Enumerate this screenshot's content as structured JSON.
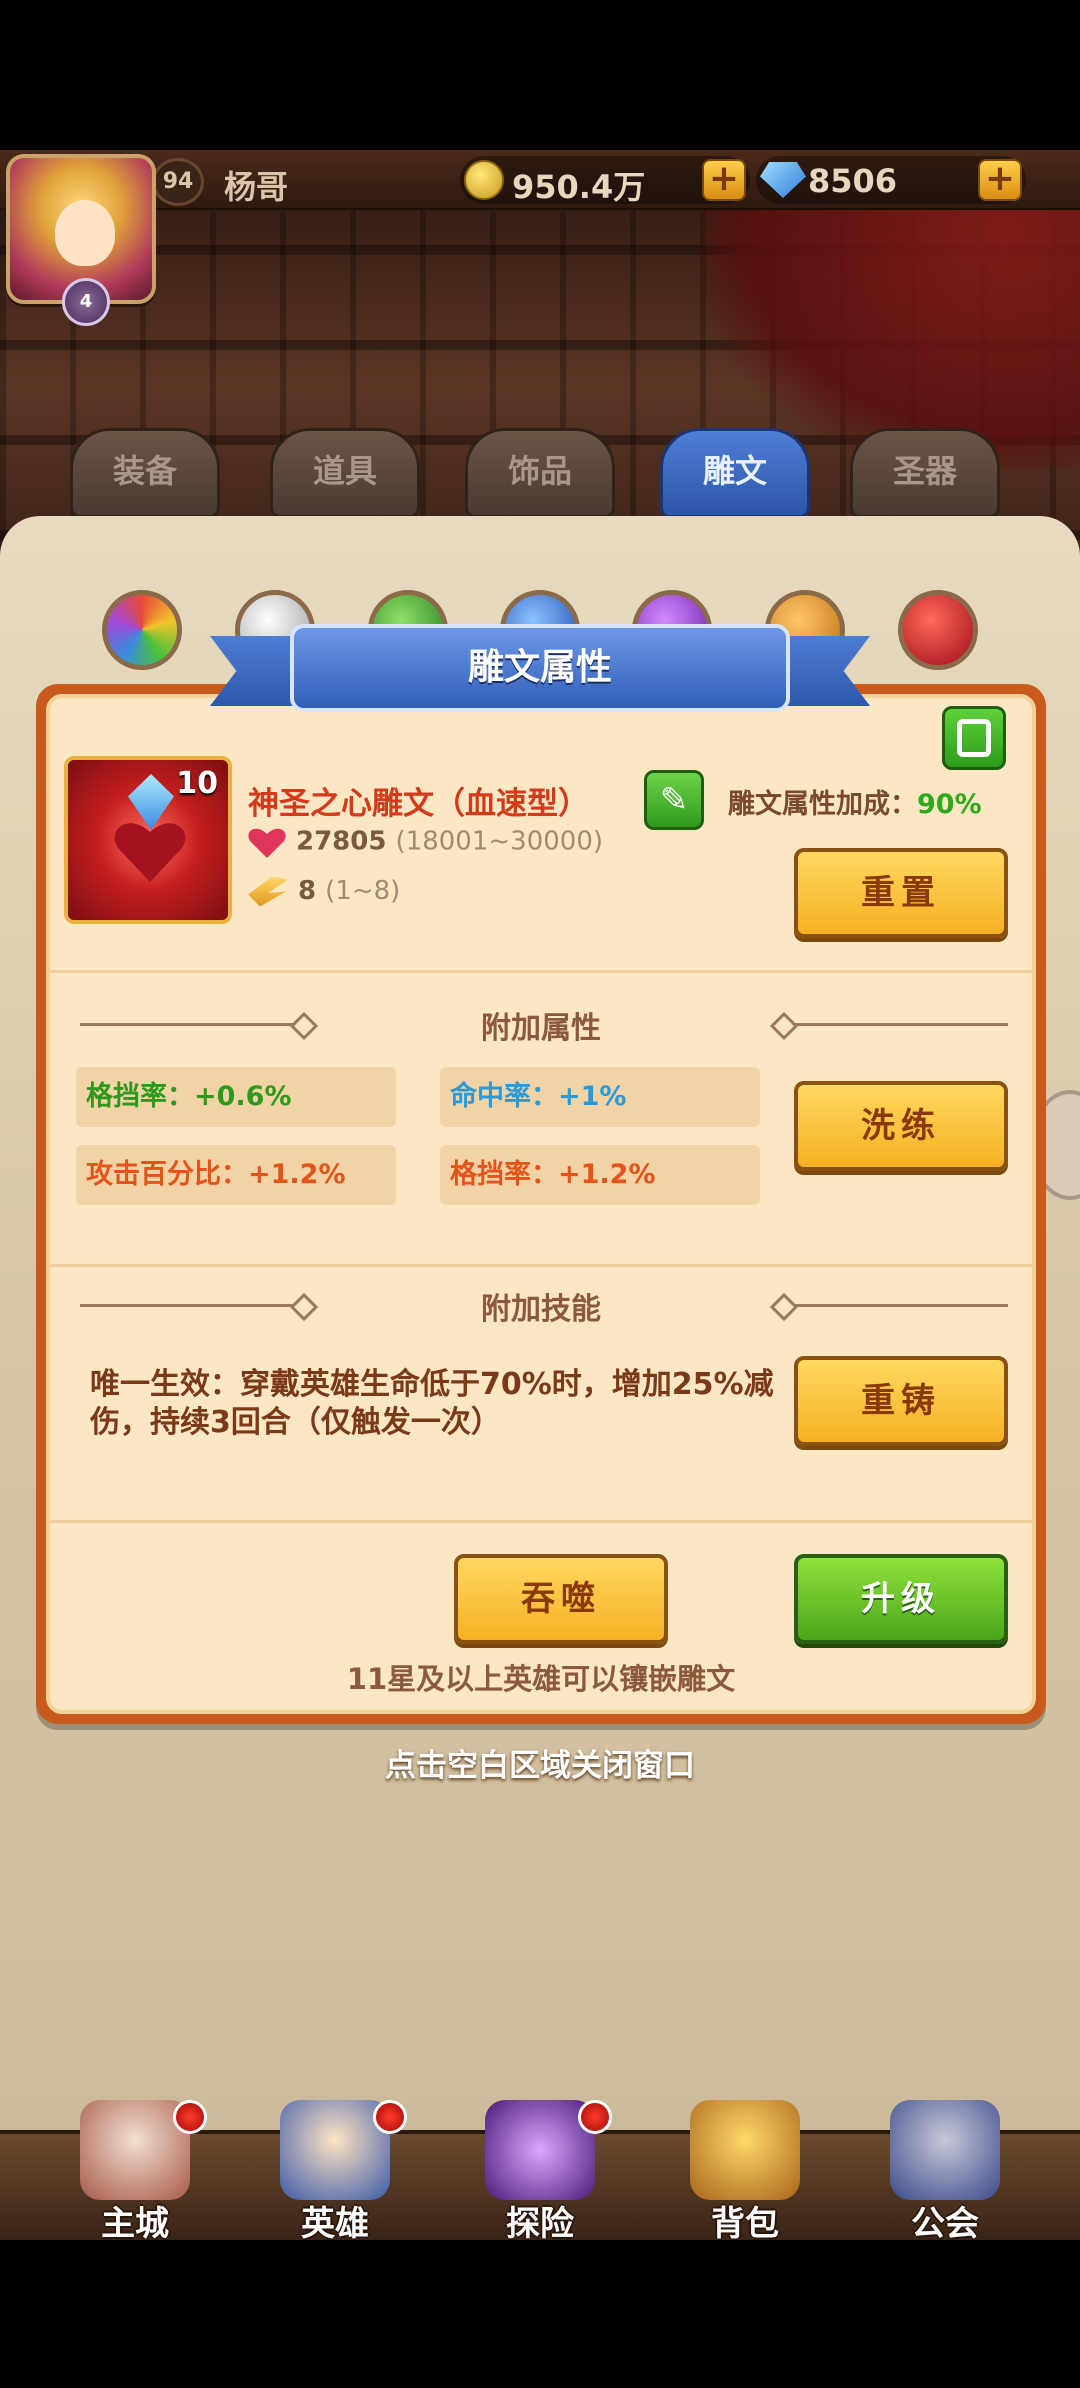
{
  "player": {
    "level": "94",
    "name": "杨哥",
    "star_badge": "4"
  },
  "resources": {
    "gold": "950.4万",
    "gems": "8506",
    "plus_symbol": "+"
  },
  "tabs": [
    {
      "label": "装备"
    },
    {
      "label": "道具"
    },
    {
      "label": "饰品"
    },
    {
      "label": "雕文"
    },
    {
      "label": "圣器"
    }
  ],
  "dialog": {
    "title": "雕文属性",
    "rune": {
      "level": "10",
      "name": "神圣之心雕文（血速型）",
      "bonus_label": "雕文属性加成：",
      "bonus_value": "90%",
      "hp_value": "27805",
      "hp_range": "(18001~30000)",
      "speed_value": "8",
      "speed_range": "(1~8)"
    },
    "reset_button": "重置",
    "extra_attributes": {
      "title": "附加属性",
      "items": [
        {
          "label": "格挡率：+0.6%",
          "color": "#2e9a1c"
        },
        {
          "label": "命中率：+1%",
          "color": "#2a9ad8"
        },
        {
          "label": "攻击百分比：+1.2%",
          "color": "#e4541a"
        },
        {
          "label": "格挡率：+1.2%",
          "color": "#e4541a"
        }
      ],
      "refine_button": "洗练"
    },
    "extra_skill": {
      "title": "附加技能",
      "text": "唯一生效：穿戴英雄生命低于70%时，增加25%减伤，持续3回合（仅触发一次）",
      "reforge_button": "重铸"
    },
    "devour_button": "吞噬",
    "upgrade_button": "升级",
    "footnote": "11星及以上英雄可以镶嵌雕文"
  },
  "close_hint": "点击空白区域关闭窗口",
  "bottom_nav": [
    {
      "label": "主城"
    },
    {
      "label": "英雄"
    },
    {
      "label": "探险"
    },
    {
      "label": "背包"
    },
    {
      "label": "公会"
    }
  ]
}
